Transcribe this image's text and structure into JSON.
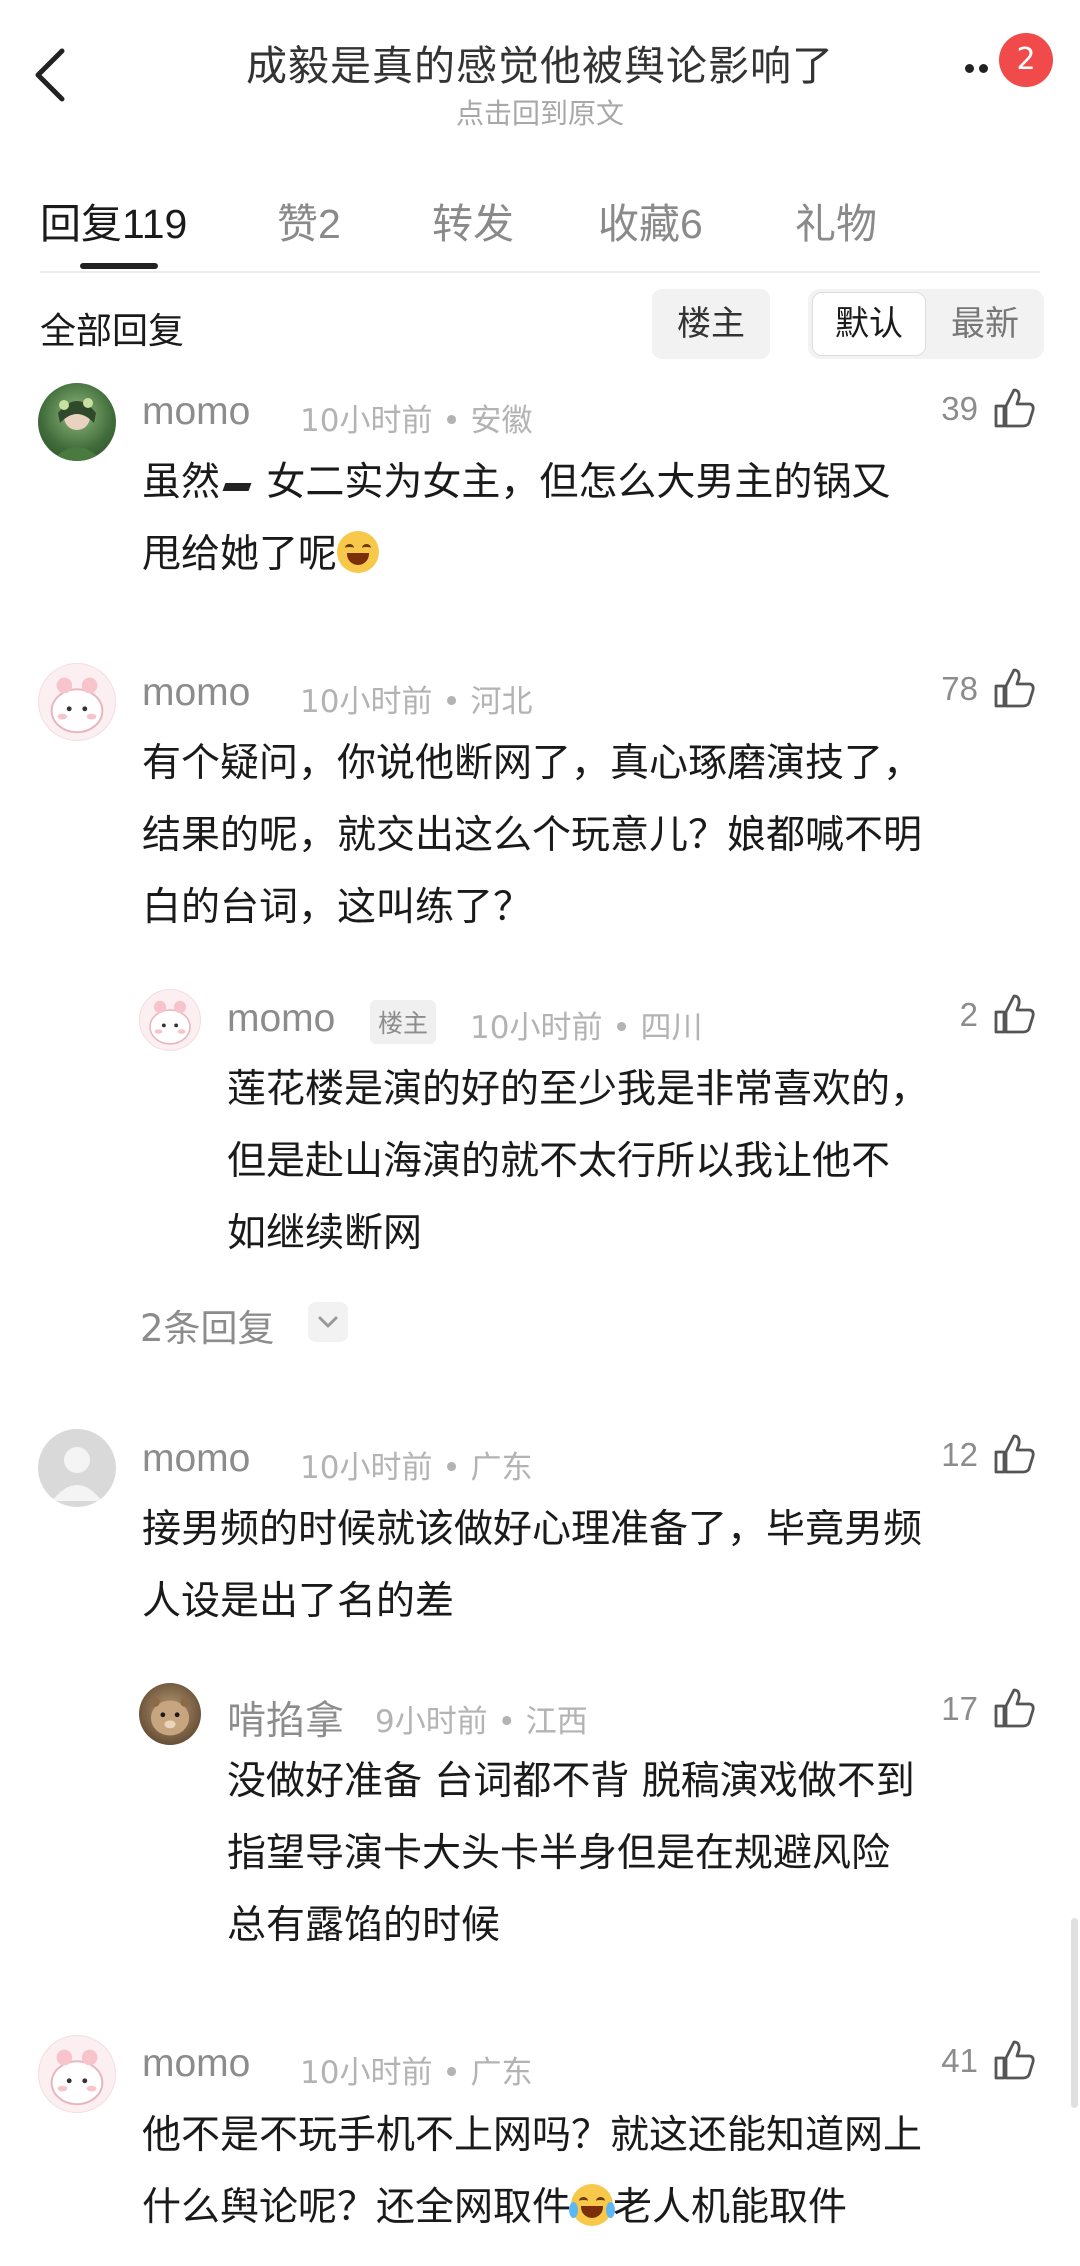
{
  "header": {
    "title": "成毅是真的感觉他被舆论影响了",
    "subtitle": "点击回到原文",
    "notification_count": "2"
  },
  "tabs": [
    {
      "label": "回复",
      "count": "119"
    },
    {
      "label": "赞",
      "count": "2"
    },
    {
      "label": "转发",
      "count": ""
    },
    {
      "label": "收藏",
      "count": "6"
    },
    {
      "label": "礼物",
      "count": ""
    }
  ],
  "filter": {
    "label": "全部回复",
    "op_only": "楼主",
    "sort_default": "默认",
    "sort_latest": "最新"
  },
  "comments": [
    {
      "user": "momo",
      "time": "10小时前",
      "location": "安徽",
      "likes": "39",
      "avatar_icon": "green-portrait-avatar",
      "lines": [
        "虽然",
        "女二实为女主，但怎么大男主的锅又",
        "甩给她了呢"
      ]
    },
    {
      "user": "momo",
      "time": "10小时前",
      "location": "河北",
      "likes": "78",
      "avatar_icon": "pink-cartoon-avatar",
      "lines": [
        "有个疑问，你说他断网了，真心琢磨演技了，",
        "结果的呢，就交出这么个玩意儿？娘都喊不明",
        "白的台词，这叫练了？"
      ],
      "reply": {
        "user": "momo",
        "op_tag": "楼主",
        "time": "10小时前",
        "location": "四川",
        "likes": "2",
        "lines": [
          "莲花楼是演的好的至少我是非常喜欢的，",
          "但是赴山海演的就不太行所以我让他不",
          "如继续断网"
        ]
      },
      "more_replies": "2条回复"
    },
    {
      "user": "momo",
      "time": "10小时前",
      "location": "广东",
      "likes": "12",
      "avatar_icon": "default-gray-avatar",
      "lines": [
        "接男频的时候就该做好心理准备了，毕竟男频",
        "人设是出了名的差"
      ],
      "reply": {
        "user": "啃掐拿",
        "time": "9小时前",
        "location": "江西",
        "likes": "17",
        "lines": [
          "没做好准备 台词都不背 脱稿演戏做不到",
          "指望导演卡大头卡半身但是在规避风险",
          "总有露馅的时候"
        ]
      }
    },
    {
      "user": "momo",
      "time": "10小时前",
      "location": "广东",
      "likes": "41",
      "avatar_icon": "pink-cartoon-avatar",
      "lines": [
        "他不是不玩手机不上网吗？就这还能知道网上",
        "什么舆论呢？还全网取件",
        "老人机能取件"
      ]
    }
  ],
  "meta_separator": "•"
}
